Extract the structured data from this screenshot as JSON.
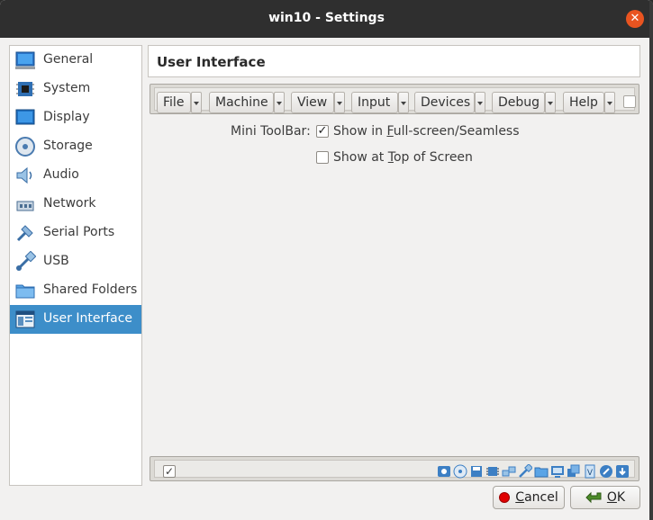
{
  "window": {
    "title": "win10 - Settings"
  },
  "sidebar": {
    "items": [
      {
        "label": "General",
        "icon": "general-icon"
      },
      {
        "label": "System",
        "icon": "system-chip-icon"
      },
      {
        "label": "Display",
        "icon": "display-monitor-icon"
      },
      {
        "label": "Storage",
        "icon": "storage-disk-icon"
      },
      {
        "label": "Audio",
        "icon": "audio-speaker-icon"
      },
      {
        "label": "Network",
        "icon": "network-icon"
      },
      {
        "label": "Serial Ports",
        "icon": "serial-port-icon"
      },
      {
        "label": "USB",
        "icon": "usb-icon"
      },
      {
        "label": "Shared Folders",
        "icon": "folder-icon"
      },
      {
        "label": "User Interface",
        "icon": "user-interface-icon"
      }
    ],
    "selected": "User Interface"
  },
  "header": {
    "title": "User Interface"
  },
  "menubar_editor": {
    "menus": [
      "File",
      "Machine",
      "View",
      "Input",
      "Devices",
      "Debug",
      "Help"
    ]
  },
  "mini_toolbar": {
    "label": "Mini ToolBar:",
    "show_fullscreen_pre": "Show in ",
    "show_fullscreen_mnemonic": "F",
    "show_fullscreen_post": "ull-screen/Seamless",
    "show_fullscreen_checked": true,
    "show_top_pre": "Show at ",
    "show_top_mnemonic": "T",
    "show_top_post": "op of Screen",
    "show_top_checked": false
  },
  "statusbar_editor": {
    "enabled": true,
    "check_glyph": "✓"
  },
  "buttons": {
    "cancel_mnemonic": "C",
    "cancel_rest": "ancel",
    "ok_mnemonic": "O",
    "ok_rest": "K"
  },
  "colors": {
    "accent": "#3d8ec9",
    "close": "#e95420",
    "titlebar": "#2f2f2f"
  }
}
